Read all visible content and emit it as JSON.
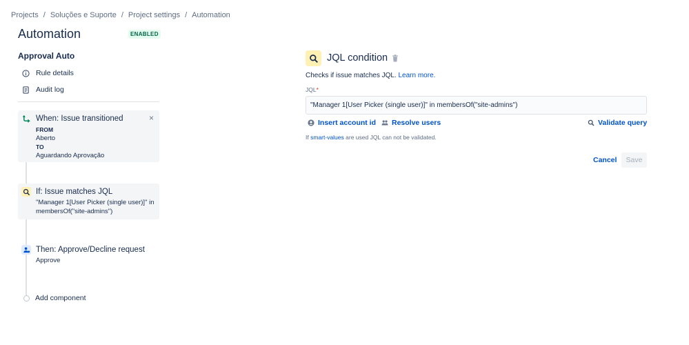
{
  "breadcrumb": [
    "Projects",
    "Soluções e Suporte",
    "Project settings",
    "Automation"
  ],
  "breadcrumb_separator": "/",
  "header": {
    "title": "Automation",
    "status": "ENABLED"
  },
  "sidebar": {
    "rule_name": "Approval Auto",
    "links": [
      {
        "label": "Rule details",
        "icon": "info-icon"
      },
      {
        "label": "Audit log",
        "icon": "document-icon"
      }
    ],
    "components": {
      "trigger": {
        "title": "When: Issue transitioned",
        "from_label": "FROM",
        "from_value": "Aberto",
        "to_label": "TO",
        "to_value": "Aguardando Aprovação",
        "close": "×"
      },
      "condition": {
        "title": "If: Issue matches JQL",
        "body": "\"Manager 1[User Picker (single user)]\" in membersOf(\"site-admins\")"
      },
      "action": {
        "title": "Then: Approve/Decline request",
        "body": "Approve"
      }
    },
    "add_component": "Add component"
  },
  "panel": {
    "title": "JQL condition",
    "description": "Checks if issue matches JQL.",
    "learn_more": "Learn more.",
    "field_label": "JQL",
    "required_marker": "*",
    "jql_value": "\"Manager 1[User Picker (single user)]\" in membersOf(\"site-admins\")",
    "insert_account_id": "Insert account id",
    "resolve_users": "Resolve users",
    "validate_query": "Validate query",
    "hint_prefix": "If",
    "hint_link": "smart-values",
    "hint_suffix": "are used JQL can not be validated.",
    "cancel": "Cancel",
    "save": "Save"
  },
  "colors": {
    "accent": "#0052cc",
    "enabled_text": "#006644",
    "enabled_bg": "#e3fcef",
    "condition_icon_bg": "#fff0b3",
    "action_icon_bg": "#deebff"
  }
}
